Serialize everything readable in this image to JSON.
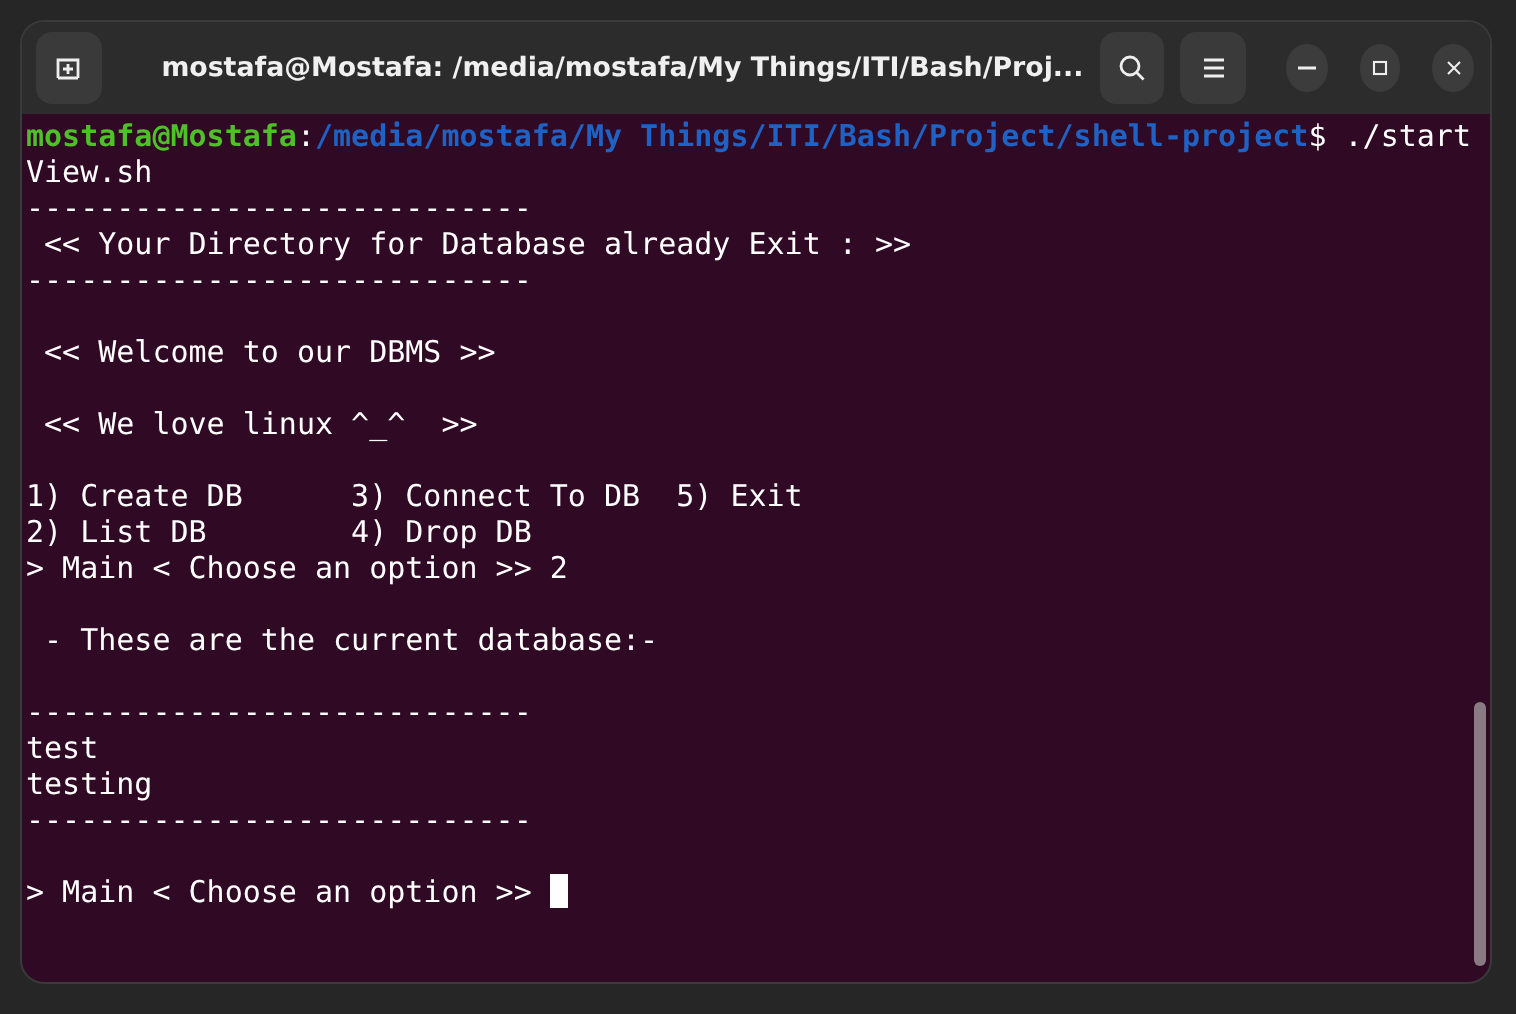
{
  "window": {
    "title": "mostafa@Mostafa: /media/mostafa/My Things/ITI/Bash/Proj..."
  },
  "terminal": {
    "lines": [
      {
        "kind": "prompt",
        "user": "mostafa@Mostafa",
        "separator": ":",
        "path": "/media/mostafa/My Things/ITI/Bash/Project/shell-project",
        "command": "$ ./start"
      },
      {
        "kind": "text",
        "text": "View.sh"
      },
      {
        "kind": "text",
        "text": "----------------------------"
      },
      {
        "kind": "text",
        "text": " << Your Directory for Database already Exit : >>"
      },
      {
        "kind": "text",
        "text": "----------------------------"
      },
      {
        "kind": "blank"
      },
      {
        "kind": "text",
        "text": " << Welcome to our DBMS >>"
      },
      {
        "kind": "blank"
      },
      {
        "kind": "text",
        "text": " << We love linux ^_^  >>"
      },
      {
        "kind": "blank"
      },
      {
        "kind": "text",
        "text": "1) Create DB      3) Connect To DB  5) Exit"
      },
      {
        "kind": "text",
        "text": "2) List DB        4) Drop DB"
      },
      {
        "kind": "text",
        "text": "> Main < Choose an option >> 2"
      },
      {
        "kind": "blank"
      },
      {
        "kind": "text",
        "text": " - These are the current database:-"
      },
      {
        "kind": "blank"
      },
      {
        "kind": "text",
        "text": "----------------------------"
      },
      {
        "kind": "text",
        "text": "test"
      },
      {
        "kind": "text",
        "text": "testing"
      },
      {
        "kind": "text",
        "text": "----------------------------"
      },
      {
        "kind": "blank"
      },
      {
        "kind": "input",
        "text": "> Main < Choose an option >> ",
        "cursor": true
      }
    ]
  }
}
